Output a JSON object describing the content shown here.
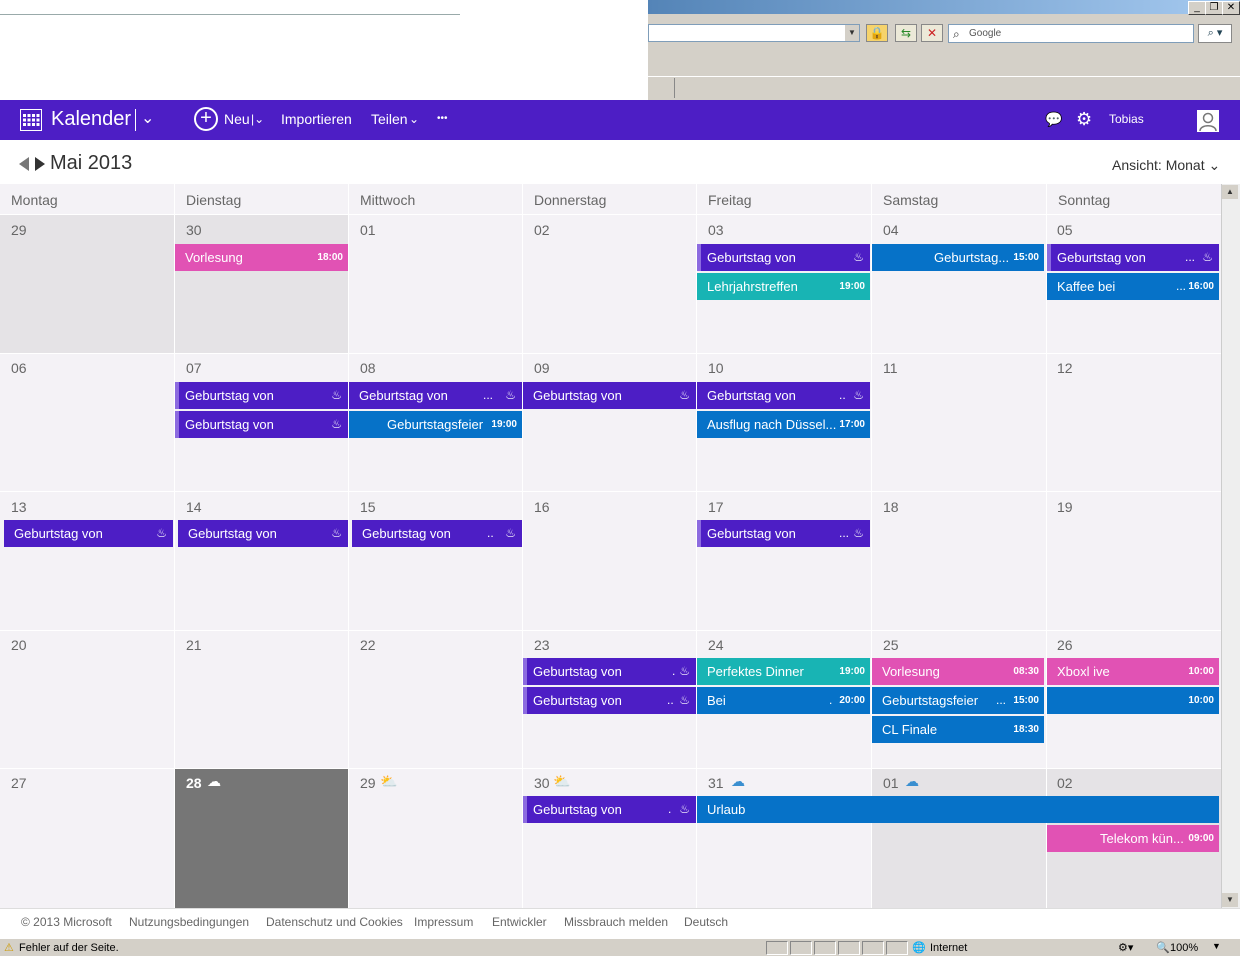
{
  "browser": {
    "search_placeholder": "Google",
    "status_text": "Fehler auf der Seite.",
    "zone": "Internet",
    "zoom": "100%"
  },
  "app": {
    "title": "Kalender",
    "new_label": "Neu",
    "import_label": "Importieren",
    "share_label": "Teilen",
    "more_label": "•••",
    "user_name": "Tobias",
    "colors": {
      "header": "#4d1ec5",
      "purple": "#4d1ec5",
      "pink": "#e152b4",
      "blue": "#0672c8",
      "teal": "#18b4b4"
    }
  },
  "calendar": {
    "month_title": "Mai 2013",
    "view_label": "Ansicht: Monat",
    "weekdays": [
      "Montag",
      "Dienstag",
      "Mittwoch",
      "Donnerstag",
      "Freitag",
      "Samstag",
      "Sonntag"
    ],
    "days": [
      [
        "29",
        "30",
        "01",
        "02",
        "03",
        "04",
        "05"
      ],
      [
        "06",
        "07",
        "08",
        "09",
        "10",
        "11",
        "12"
      ],
      [
        "13",
        "14",
        "15",
        "16",
        "17",
        "18",
        "19"
      ],
      [
        "20",
        "21",
        "22",
        "23",
        "24",
        "25",
        "26"
      ],
      [
        "27",
        "28",
        "29",
        "30",
        "31",
        "01",
        "02"
      ]
    ],
    "events": [
      {
        "title": "Vorlesung",
        "time": "18:00"
      },
      {
        "title": "Geburtstag von"
      },
      {
        "title": "Lehrjahrstreffen",
        "time": "19:00"
      },
      {
        "title": "Geburtstag...",
        "time": "15:00"
      },
      {
        "title": "Geburtstag von",
        "extra": "..."
      },
      {
        "title": "Kaffee bei",
        "extra": "...",
        "time": "16:00"
      },
      {
        "title": "Geburtstag von"
      },
      {
        "title": "Geburtstag von"
      },
      {
        "title": "Geburtstag von",
        "extra": "..."
      },
      {
        "title": "Geburtstagsfeier",
        "time": "19:00"
      },
      {
        "title": "Geburtstag von"
      },
      {
        "title": "Geburtstag von",
        "extra": ".."
      },
      {
        "title": "Ausflug nach Düssel...",
        "time": "17:00"
      },
      {
        "title": "Geburtstag von"
      },
      {
        "title": "Geburtstag von"
      },
      {
        "title": "Geburtstag von",
        "extra": ".."
      },
      {
        "title": "Geburtstag von",
        "extra": "..."
      },
      {
        "title": "Geburtstag von",
        "extra": "."
      },
      {
        "title": "Geburtstag von",
        "extra": ".."
      },
      {
        "title": "Perfektes Dinner",
        "time": "19:00"
      },
      {
        "title": "Bei",
        "extra": ".",
        "time": "20:00"
      },
      {
        "title": "Vorlesung",
        "time": "08:30"
      },
      {
        "title": "Geburtstagsfeier",
        "extra": "...",
        "time": "15:00"
      },
      {
        "title": "CL Finale",
        "time": "18:30"
      },
      {
        "title": "Xboxl ive",
        "time": "10:00"
      },
      {
        "title": "",
        "time": "10:00"
      },
      {
        "title": "Geburtstag von",
        "extra": "."
      },
      {
        "title": "Urlaub"
      },
      {
        "title": "Telekom kün...",
        "time": "09:00"
      }
    ]
  },
  "footer": {
    "links": [
      "© 2013 Microsoft",
      "Nutzungsbedingungen",
      "Datenschutz und Cookies",
      "Impressum",
      "Entwickler",
      "Missbrauch melden",
      "Deutsch"
    ]
  }
}
